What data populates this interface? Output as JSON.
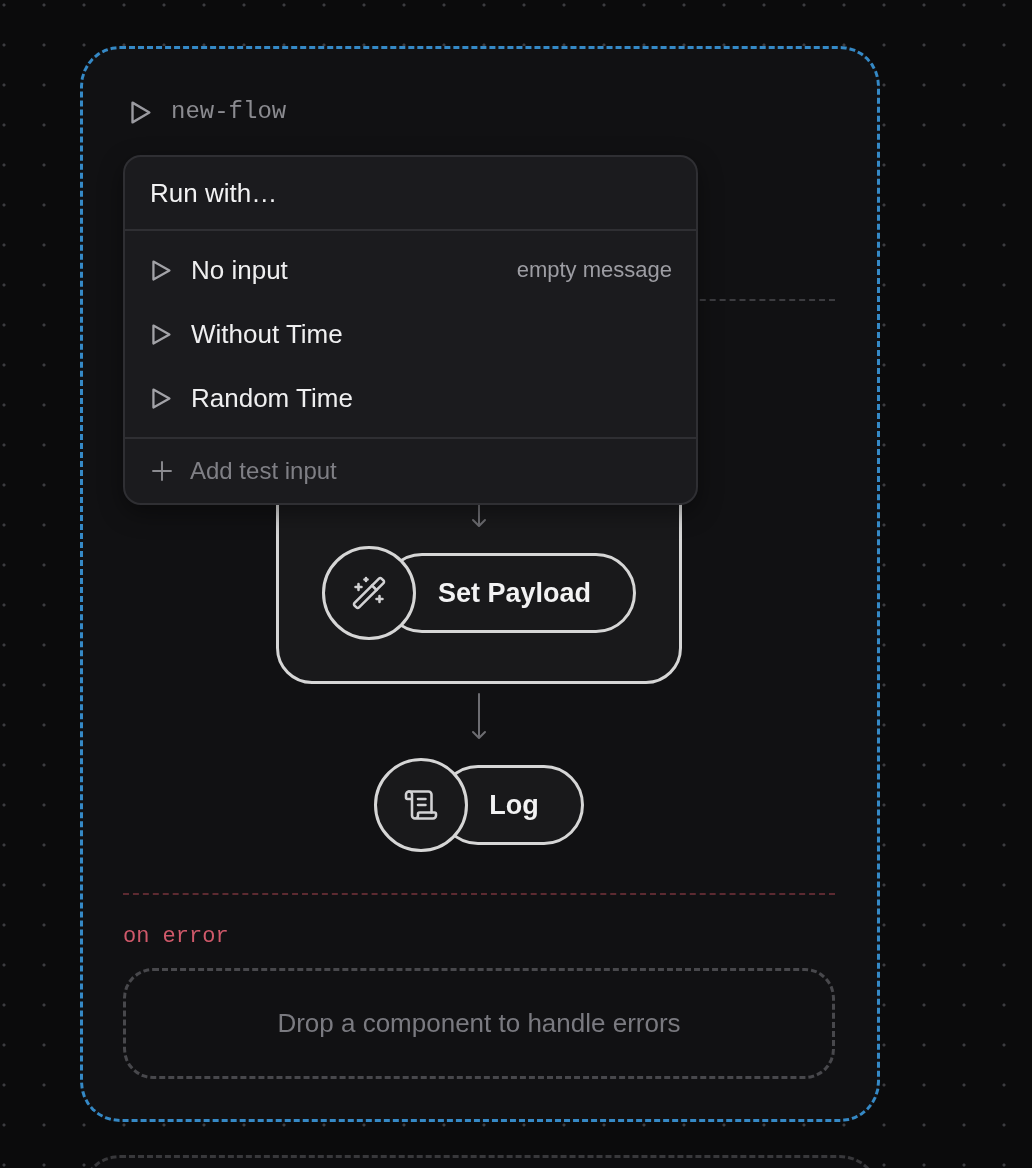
{
  "flow": {
    "title": "new-flow"
  },
  "run_menu": {
    "title": "Run with…",
    "items": [
      {
        "label": "No input",
        "hint": "empty message"
      },
      {
        "label": "Without Time"
      },
      {
        "label": "Random Time"
      }
    ],
    "add_action": "Add test input"
  },
  "steps": [
    {
      "kind": "group",
      "children": [
        {
          "kind": "setter",
          "label": "Set Payload"
        }
      ]
    },
    {
      "kind": "logger",
      "label": "Log"
    }
  ],
  "error_handler": {
    "label": "on error",
    "hint": "Drop a component to handle errors"
  }
}
